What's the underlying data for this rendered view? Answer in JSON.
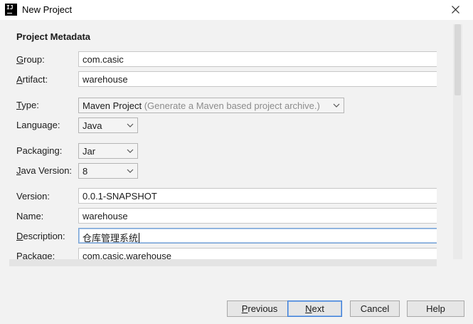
{
  "window": {
    "title": "New Project",
    "app_icon_text": "IJ"
  },
  "section": {
    "title": "Project Metadata"
  },
  "fields": {
    "group": {
      "label_mnemonic": "G",
      "label_rest": "roup:",
      "value": "com.casic"
    },
    "artifact": {
      "label_mnemonic": "A",
      "label_rest": "rtifact:",
      "value": "warehouse"
    },
    "type": {
      "label_mnemonic": "T",
      "label_rest": "ype:",
      "value": "Maven Project",
      "hint": "(Generate a Maven based project archive.)"
    },
    "language": {
      "label": "Language:",
      "value": "Java"
    },
    "packaging": {
      "label": "Packaging:",
      "value": "Jar"
    },
    "java_version": {
      "label_mnemonic": "J",
      "label_rest": "ava Version:",
      "value": "8"
    },
    "version": {
      "label": "Version:",
      "value": "0.0.1-SNAPSHOT"
    },
    "name": {
      "label": "Name:",
      "value": "warehouse"
    },
    "description": {
      "label_mnemonic": "D",
      "label_rest": "escription:",
      "value": "仓库管理系统"
    },
    "package": {
      "label": "Package:",
      "value": "com.casic.warehouse"
    }
  },
  "buttons": {
    "previous": {
      "mnemonic": "P",
      "rest": "revious"
    },
    "next": {
      "mnemonic": "N",
      "rest": "ext"
    },
    "cancel": "Cancel",
    "help": "Help"
  },
  "colors": {
    "focus_border": "#7aa5d6",
    "default_button_border": "#3d7dd6",
    "dialog_bg": "#f2f2f2"
  }
}
